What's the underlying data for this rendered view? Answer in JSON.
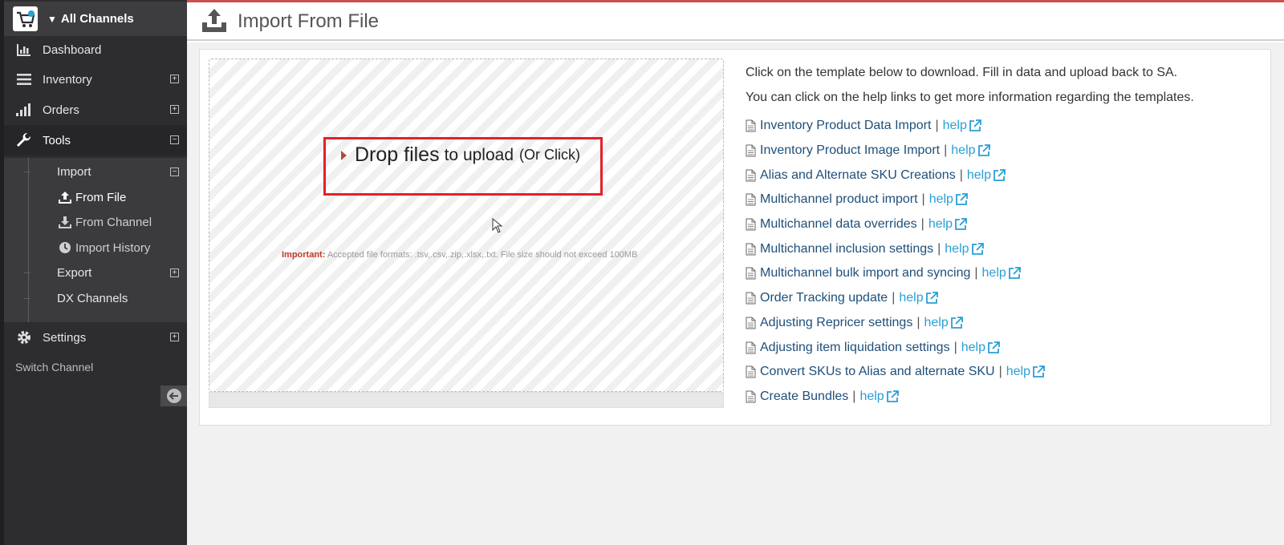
{
  "app": {
    "channel_label": "All Channels",
    "page_title": "Import From File"
  },
  "sidebar": {
    "items": [
      {
        "label": "Dashboard",
        "icon": "bar-chart-icon"
      },
      {
        "label": "Inventory",
        "icon": "list-icon",
        "expand": "plus"
      },
      {
        "label": "Orders",
        "icon": "signal-icon",
        "expand": "plus"
      },
      {
        "label": "Tools",
        "icon": "wrench-icon",
        "expand": "minus",
        "active": true
      },
      {
        "label": "Settings",
        "icon": "gear-icon",
        "expand": "plus"
      }
    ],
    "submenu": {
      "import": "Import",
      "from_file": "From File",
      "from_channel": "From Channel",
      "import_history": "Import History",
      "export": "Export",
      "dx_channels": "DX Channels"
    },
    "switch_channel": "Switch Channel"
  },
  "dropzone": {
    "big": "Drop files",
    "mid": "to upload",
    "small": "(Or Click)",
    "important_label": "Important:",
    "note": "Accepted file formats: .tsv,.csv,.zip,.xlsx,.txt. File size should not exceed 100MB"
  },
  "instructions": {
    "line1": "Click on the template below to download. Fill in data and upload back to SA.",
    "line2": "You can click on the help links to get more information regarding the templates."
  },
  "templates": [
    {
      "name": "Inventory Product Data Import",
      "help": "help"
    },
    {
      "name": "Inventory Product Image Import",
      "help": "help"
    },
    {
      "name": "Alias and Alternate SKU Creations",
      "help": "help"
    },
    {
      "name": "Multichannel product import",
      "help": "help"
    },
    {
      "name": "Multichannel data overrides",
      "help": "help"
    },
    {
      "name": "Multichannel inclusion settings",
      "help": "help"
    },
    {
      "name": "Multichannel bulk import and syncing",
      "help": "help"
    },
    {
      "name": "Order Tracking update",
      "help": "help"
    },
    {
      "name": "Adjusting Repricer settings",
      "help": "help"
    },
    {
      "name": "Adjusting item liquidation settings",
      "help": "help"
    },
    {
      "name": "Convert SKUs to Alias and alternate SKU",
      "help": "help"
    },
    {
      "name": "Create Bundles",
      "help": "help"
    }
  ],
  "colors": {
    "sidebar_bg": "#2d2d30",
    "link": "#2a9fd6",
    "highlight": "#e5202a",
    "accent_top": "#c9514d"
  }
}
